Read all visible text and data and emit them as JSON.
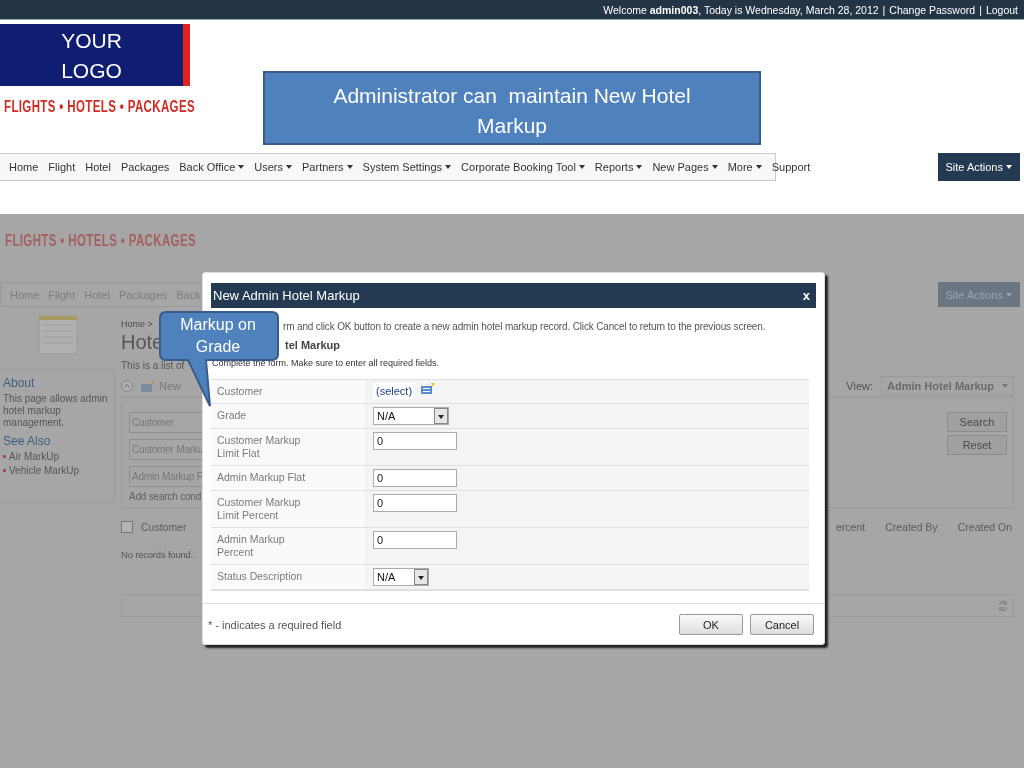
{
  "top_bar": {
    "welcome": "Welcome **admin003**, Today is Wednesday, March 28, 2012",
    "separator": "|",
    "links": [
      "Change Password",
      "Logout"
    ]
  },
  "logo": {
    "text": "YOUR LOGO"
  },
  "tagline": "FLIGHTS • HOTELS • PACKAGES",
  "banner_callout": "Administrator can  maintain New Hotel Markup",
  "nav": {
    "items": [
      {
        "label": "Home",
        "dropdown": false
      },
      {
        "label": "Flight",
        "dropdown": false
      },
      {
        "label": "Hotel",
        "dropdown": false
      },
      {
        "label": "Packages",
        "dropdown": false
      },
      {
        "label": "Back Office",
        "dropdown": true
      },
      {
        "label": "Users",
        "dropdown": true
      },
      {
        "label": "Partners",
        "dropdown": true
      },
      {
        "label": "System Settings",
        "dropdown": true
      },
      {
        "label": "Corporate Booking Tool",
        "dropdown": true
      },
      {
        "label": "Reports",
        "dropdown": true
      },
      {
        "label": "New Pages",
        "dropdown": true
      },
      {
        "label": "More",
        "dropdown": true
      },
      {
        "label": "Support",
        "dropdown": false
      }
    ],
    "site_actions": "Site Actions"
  },
  "background_page": {
    "tagline": "FLIGHTS • HOTELS • PACKAGES",
    "nav_items": [
      "Home",
      "Flight",
      "Hotel",
      "Packages",
      "Back"
    ],
    "site_actions": "Site Actions",
    "sidebar": {
      "about_title": "About",
      "about_text": "This page allows admin hotel markup management.",
      "see_also_title": "See Also",
      "links": [
        "Air MarkUp",
        "Vehicle MarkUp"
      ]
    },
    "breadcrumb": "Home >",
    "title": "Hote",
    "description": "This is a list of",
    "new_button": "New",
    "view_label": "View:",
    "view_value": "Admin Hotel Markup",
    "search_fields": [
      "Customer",
      "Customer Marku",
      "Admin Markup F"
    ],
    "add_condition": "Add search cond",
    "buttons": [
      "Search",
      "Reset"
    ],
    "select_all_checked": false,
    "columns_left": [
      "Customer"
    ],
    "columns_right": [
      "ercent",
      "Created By",
      "Created On"
    ],
    "empty_message": "No records found."
  },
  "dialog": {
    "title": "New Admin Hotel Markup",
    "close": "x",
    "intro": "rm and click OK button to create a new admin hotel markup record. Click Cancel to return to the previous screen.",
    "heading": "tel Markup",
    "instruction": "Complete the form. Make sure to enter all required fields.",
    "fields": [
      {
        "label": "Customer",
        "kind": "picker",
        "value": "(select)"
      },
      {
        "label": "Grade",
        "kind": "select",
        "value": "N/A"
      },
      {
        "label": "Customer Markup Limit Flat",
        "kind": "input",
        "value": "0"
      },
      {
        "label": "Admin Markup Flat",
        "kind": "input",
        "value": "0"
      },
      {
        "label": "Customer Markup Limit Percent",
        "kind": "input",
        "value": "0"
      },
      {
        "label": "Admin Markup Percent",
        "kind": "input",
        "value": "0"
      },
      {
        "label": "Status Description",
        "kind": "select",
        "value": "N/A"
      }
    ],
    "footnote": "* - indicates a required field",
    "buttons": [
      "OK",
      "Cancel"
    ]
  },
  "grade_callout": "Markup on Grade"
}
